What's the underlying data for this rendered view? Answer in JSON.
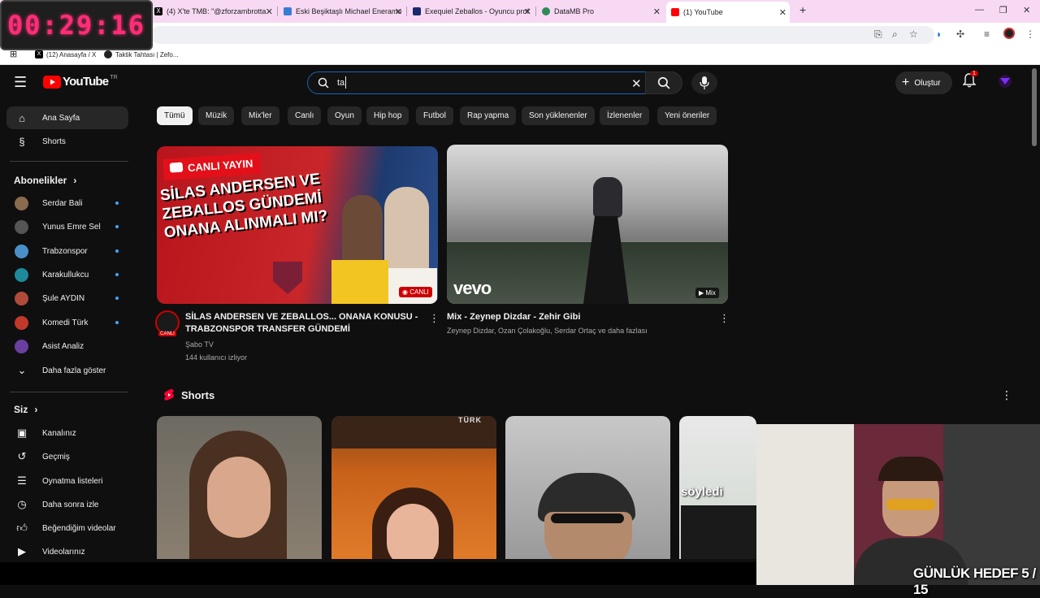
{
  "timer": "00:29:16",
  "tabs": [
    {
      "label": "(4) X'te TMB: \"@zforzambrotta",
      "color": "#000000"
    },
    {
      "label": "Eski Beşiktaşlı Michael Eneramo",
      "color": "#3a7bd5"
    },
    {
      "label": "Exequiel Zeballos - Oyuncu prof",
      "color": "#1a2a6c"
    },
    {
      "label": "DataMB Pro",
      "color": "#2e8b57"
    },
    {
      "label": "(1) YouTube",
      "color": "#ff0000"
    }
  ],
  "bookmarks": [
    {
      "label": "(12) Anasayfa / X"
    },
    {
      "label": "Taktik Tahtası | Zefo..."
    }
  ],
  "header": {
    "logo": "YouTube",
    "region": "TR",
    "search_value": "ta",
    "create_label": "Oluştur",
    "notif_count": "1"
  },
  "sidebar": {
    "main": [
      {
        "label": "Ana Sayfa",
        "icon": "home-icon"
      },
      {
        "label": "Shorts",
        "icon": "shorts-icon"
      }
    ],
    "subs_title": "Abonelikler",
    "subs": [
      {
        "label": "Serdar Bali",
        "color": "#8a6b4e"
      },
      {
        "label": "Yunus Emre Sel",
        "color": "#555555"
      },
      {
        "label": "Trabzonspor",
        "color": "#4a90c8"
      },
      {
        "label": "Karakullukcu",
        "color": "#1e8a9a"
      },
      {
        "label": "Şule AYDIN",
        "color": "#b04a3a"
      },
      {
        "label": "Komedi Türk",
        "color": "#c0392b"
      },
      {
        "label": "Asist Analiz",
        "color": "#6b3fa0"
      }
    ],
    "show_more": "Daha fazla göster",
    "you_title": "Siz",
    "you": [
      {
        "label": "Kanalınız",
        "icon": "channel-icon"
      },
      {
        "label": "Geçmiş",
        "icon": "history-icon"
      },
      {
        "label": "Oynatma listeleri",
        "icon": "playlist-icon"
      },
      {
        "label": "Daha sonra izle",
        "icon": "watch-later-icon"
      },
      {
        "label": "Beğendiğim videolar",
        "icon": "like-icon"
      },
      {
        "label": "Videolarınız",
        "icon": "your-videos-icon"
      }
    ]
  },
  "chips": [
    "Tümü",
    "Müzik",
    "Mix'ler",
    "Canlı",
    "Oyun",
    "Hip hop",
    "Futbol",
    "Rap yapma",
    "Son yüklenenler",
    "İzlenenler",
    "Yeni öneriler"
  ],
  "videos": [
    {
      "title": "SİLAS ANDERSEN VE ZEBALLOS... ONANA KONUSU - TRABZONSPOR TRANSFER GÜNDEMİ",
      "channel": "Şabo TV",
      "meta": "144 kullanıcı izliyor",
      "thumb_banner": "CANLI YAYIN",
      "thumb_text": "SİLAS ANDERSEN VE ZEBALLOS GÜNDEMİ ONANA ALINMALI MI?",
      "badge": "CANLI",
      "avatar_badge": "CANLI"
    },
    {
      "title": "Mix - Zeynep Dizdar - Zehir Gibi",
      "meta": "Zeynep Dizdar, Ozan Çolakoğlu, Serdar Ortaç ve daha fazlası",
      "badge": "Mix",
      "watermark": "vevo"
    }
  ],
  "shorts_title": "Shorts",
  "shorts_overlays": [
    "",
    "TÜRK",
    "",
    "söyledi"
  ],
  "webcam_caption": "GÜNLÜK HEDEF 5 / 15"
}
